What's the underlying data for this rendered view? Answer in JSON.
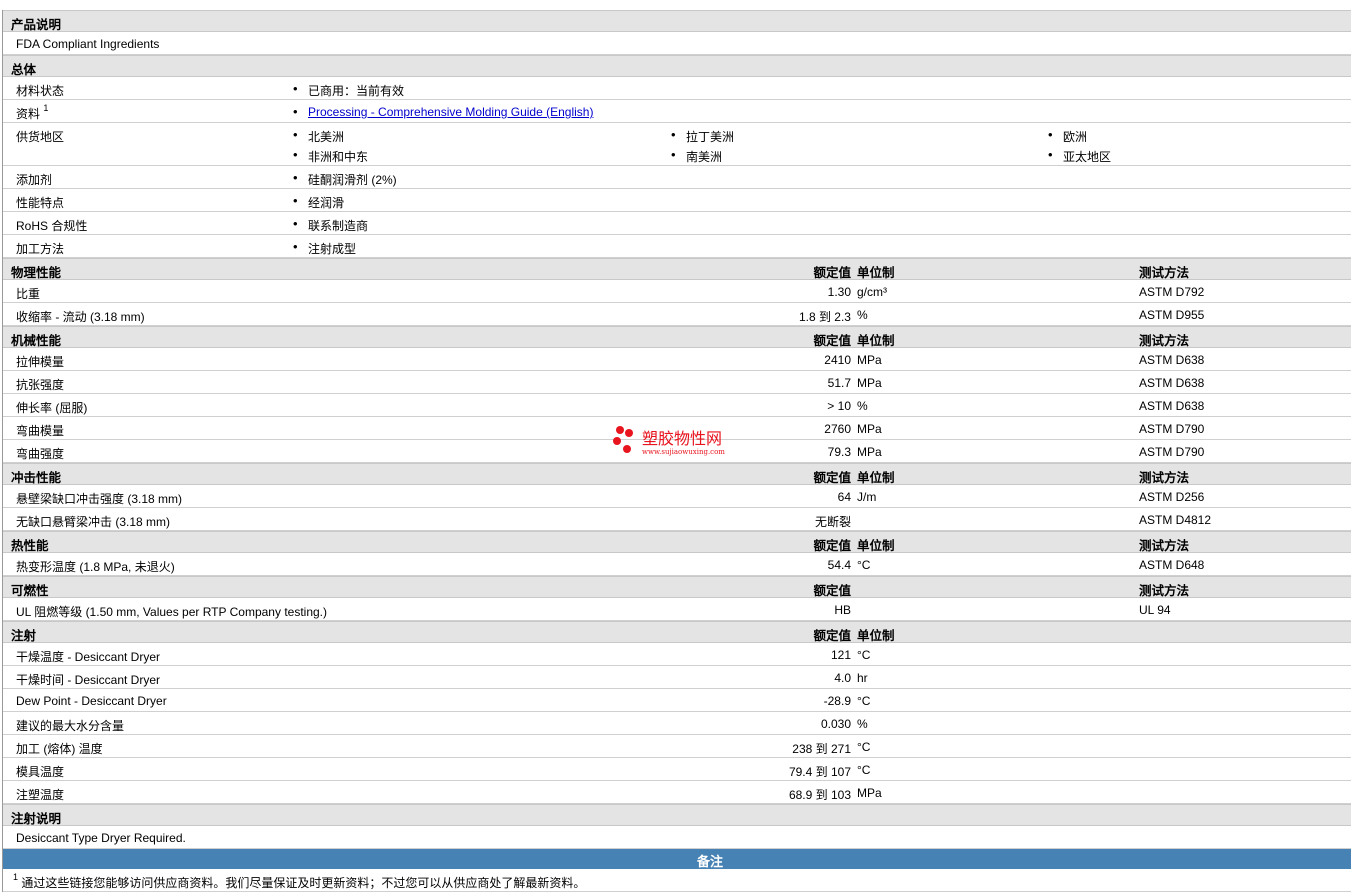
{
  "description": {
    "title": "产品说明",
    "text": "FDA Compliant Ingredients"
  },
  "general": {
    "title": "总体",
    "rows": [
      {
        "label": "材料状态",
        "items": [
          "已商用：当前有效"
        ]
      },
      {
        "label": "资料",
        "sup": "1",
        "link": "Processing - Comprehensive Molding Guide (English)"
      },
      {
        "label": "供货地区",
        "items": [
          "北美洲",
          "拉丁美洲",
          "欧洲",
          "非洲和中东",
          "南美洲",
          "亚太地区"
        ]
      },
      {
        "label": "添加剂",
        "items": [
          "硅酮润滑剂 (2%)"
        ]
      },
      {
        "label": "性能特点",
        "items": [
          "经润滑"
        ]
      },
      {
        "label": "RoHS 合规性",
        "items": [
          "联系制造商"
        ]
      },
      {
        "label": "加工方法",
        "items": [
          "注射成型"
        ]
      }
    ]
  },
  "col_headers": {
    "value": "额定值",
    "unit": "单位制",
    "test": "测试方法"
  },
  "sections": [
    {
      "title": "物理性能",
      "unit_col": true,
      "test_col": true,
      "rows": [
        {
          "label": "比重",
          "value": "1.30",
          "unit": "g/cm³",
          "test": "ASTM D792"
        },
        {
          "label": "收缩率 - 流动 (3.18 mm)",
          "value": "1.8 到  2.3",
          "unit": "%",
          "test": "ASTM D955"
        }
      ]
    },
    {
      "title": "机械性能",
      "unit_col": true,
      "test_col": true,
      "rows": [
        {
          "label": "拉伸模量",
          "value": "2410",
          "unit": "MPa",
          "test": "ASTM D638"
        },
        {
          "label": "抗张强度",
          "value": "51.7",
          "unit": "MPa",
          "test": "ASTM D638"
        },
        {
          "label": "伸长率 (屈服)",
          "value": "> 10",
          "unit": "%",
          "test": "ASTM D638"
        },
        {
          "label": "弯曲模量",
          "value": "2760",
          "unit": "MPa",
          "test": "ASTM D790"
        },
        {
          "label": "弯曲强度",
          "value": "79.3",
          "unit": "MPa",
          "test": "ASTM D790"
        }
      ]
    },
    {
      "title": "冲击性能",
      "unit_col": true,
      "test_col": true,
      "rows": [
        {
          "label": "悬壁梁缺口冲击强度 (3.18 mm)",
          "value": "64",
          "unit": "J/m",
          "test": "ASTM D256"
        },
        {
          "label": "无缺口悬臂梁冲击 (3.18 mm)",
          "value": "无断裂",
          "unit": "",
          "test": "ASTM D4812"
        }
      ]
    },
    {
      "title": "热性能",
      "unit_col": true,
      "test_col": true,
      "rows": [
        {
          "label": "热变形温度 (1.8 MPa, 未退火)",
          "value": "54.4",
          "unit": "°C",
          "test": "ASTM D648"
        }
      ]
    },
    {
      "title": "可燃性",
      "unit_col": false,
      "test_col": true,
      "rows": [
        {
          "label": "UL 阻燃等级 (1.50 mm, Values per RTP Company testing.)",
          "value": "HB",
          "unit": "",
          "test": "UL 94"
        }
      ]
    },
    {
      "title": "注射",
      "unit_col": true,
      "test_col": false,
      "rows": [
        {
          "label": "干燥温度 - Desiccant Dryer",
          "value": "121",
          "unit": "°C",
          "test": ""
        },
        {
          "label": "干燥时间 - Desiccant Dryer",
          "value": "4.0",
          "unit": "hr",
          "test": ""
        },
        {
          "label": "Dew Point - Desiccant Dryer",
          "value": "-28.9",
          "unit": "°C",
          "test": ""
        },
        {
          "label": "建议的最大水分含量",
          "value": "0.030",
          "unit": "%",
          "test": ""
        },
        {
          "label": "加工 (熔体) 温度",
          "value": "238 到  271",
          "unit": "°C",
          "test": ""
        },
        {
          "label": "模具温度",
          "value": "79.4 到  107",
          "unit": "°C",
          "test": ""
        },
        {
          "label": "注塑温度",
          "value": "68.9 到  103",
          "unit": "MPa",
          "test": ""
        }
      ]
    }
  ],
  "injection_notes": {
    "title": "注射说明",
    "text": "Desiccant Type Dryer Required."
  },
  "remarks": {
    "title": "备注",
    "sup": "1",
    "text": "通过这些链接您能够访问供应商资料。我们尽量保证及时更新资料；不过您可以从供应商处了解最新资料。"
  },
  "watermark": {
    "name": "塑胶物性网",
    "url": "www.sujiaowuxing.com",
    "color": "#e8141e"
  }
}
